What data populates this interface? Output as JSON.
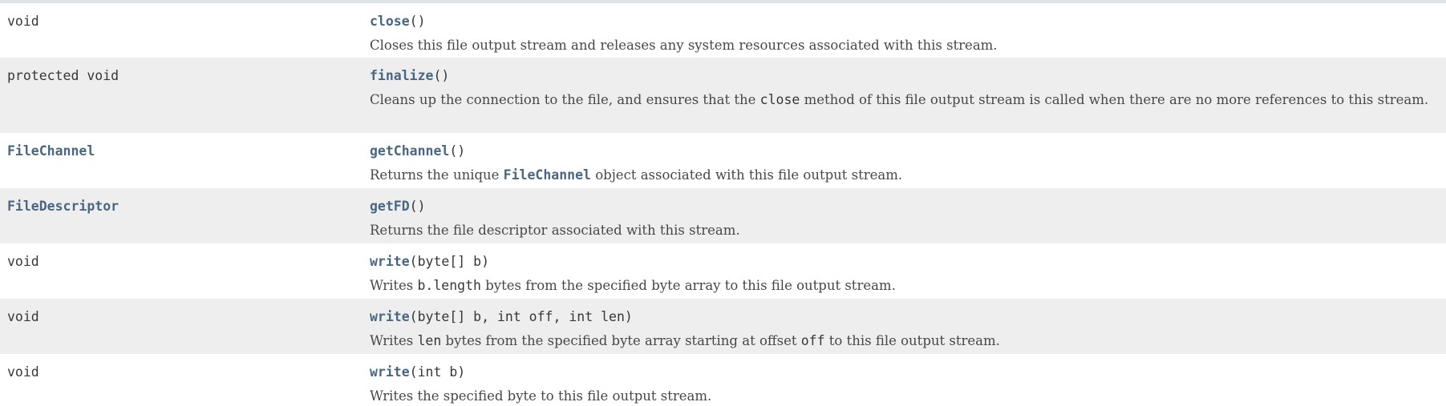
{
  "methods": [
    {
      "type": "void",
      "type_is_link": false,
      "name": "close",
      "params": "()",
      "desc": [
        "Closes this file output stream and releases any system resources associated with this stream."
      ]
    },
    {
      "type": "protected void",
      "type_is_link": false,
      "name": "finalize",
      "params": "()",
      "desc": [
        "Cleans up the connection to the file, and ensures that the ",
        "close",
        " method of this file output stream is called when there are no more references to this stream."
      ]
    },
    {
      "type": "FileChannel",
      "type_is_link": true,
      "name": "getChannel",
      "params": "()",
      "desc": [
        "Returns the unique ",
        "FileChannel",
        " object associated with this file output stream."
      ]
    },
    {
      "type": "FileDescriptor",
      "type_is_link": true,
      "name": "getFD",
      "params": "()",
      "desc": [
        "Returns the file descriptor associated with this stream."
      ]
    },
    {
      "type": "void",
      "type_is_link": false,
      "name": "write",
      "params": "(byte[] b)",
      "desc": [
        "Writes ",
        "b.length",
        " bytes from the specified byte array to this file output stream."
      ]
    },
    {
      "type": "void",
      "type_is_link": false,
      "name": "write",
      "params": "(byte[] b, int off, int len)",
      "desc": [
        "Writes ",
        "len",
        " bytes from the specified byte array starting at offset ",
        "off",
        " to this file output stream."
      ]
    },
    {
      "type": "void",
      "type_is_link": false,
      "name": "write",
      "params": "(int b)",
      "desc": [
        "Writes the specified byte to this file output stream."
      ]
    }
  ],
  "colors": {
    "link": "#4a6782",
    "alt_row": "#eeeeef",
    "text": "#353833",
    "header_border": "#dee3e9"
  }
}
